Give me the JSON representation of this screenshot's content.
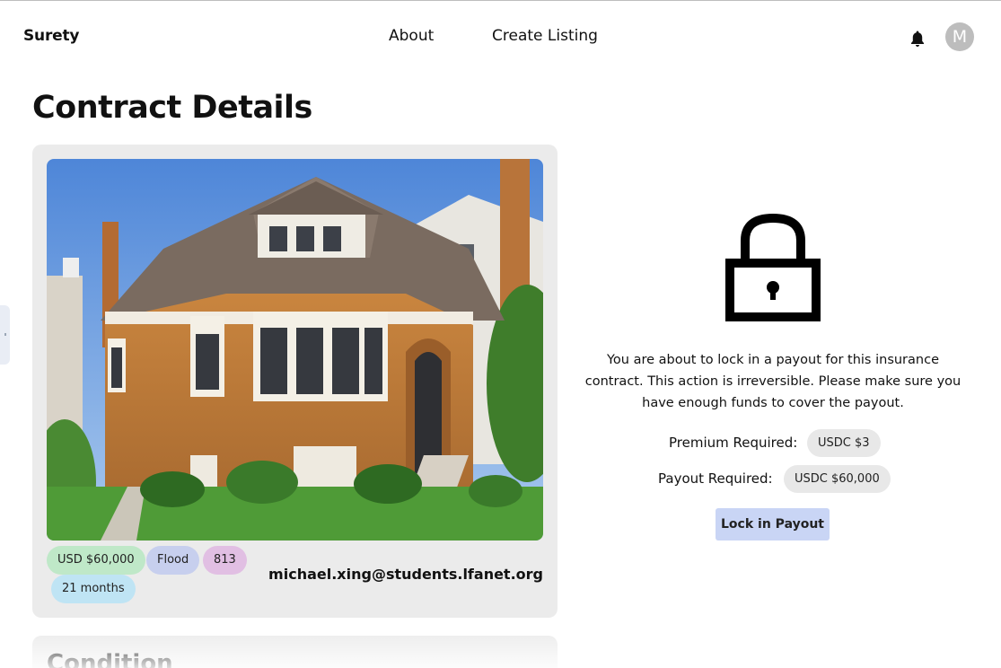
{
  "nav": {
    "brand": "Surety",
    "links": [
      "About",
      "Create Listing"
    ],
    "avatar_initial": "M",
    "icons": {
      "notifications": "bell-icon"
    }
  },
  "page": {
    "title": "Contract Details"
  },
  "contract": {
    "image_icon": "house-photo",
    "tags": {
      "amount": "USD $60,000",
      "peril": "Flood",
      "zip": "813",
      "duration": "21 months"
    },
    "owner_email": "michael.xing@students.lfanet.org",
    "tag_colors": {
      "amount": "#bfe8c8",
      "peril": "#c7cfee",
      "zip": "#e1bfe3",
      "duration": "#bfe4f4"
    }
  },
  "condition": {
    "title": "Condition"
  },
  "lock_panel": {
    "icon": "padlock-icon",
    "warning": "You are about to lock in a payout for this insurance contract. This action is irreversible. Please make sure you have enough funds to cover the payout.",
    "premium_label": "Premium Required:",
    "premium_value": "USDC $3",
    "payout_label": "Payout Required:",
    "payout_value": "USDC $60,000",
    "button_label": "Lock in Payout",
    "button_color": "#c9d5f5"
  }
}
